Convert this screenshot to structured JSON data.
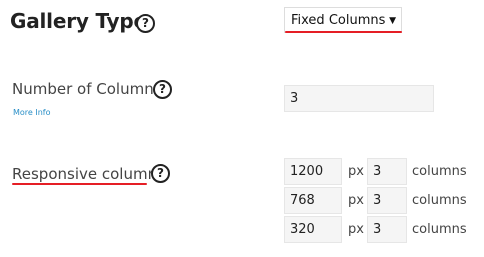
{
  "gallery_type": {
    "title": "Gallery Type",
    "help_glyph": "?",
    "select": {
      "selected": "Fixed Columns",
      "caret": "▼"
    }
  },
  "number_of_columns": {
    "label": "Number of Columns",
    "help_glyph": "?",
    "more_info": "More Info",
    "value": "3"
  },
  "responsive_columns": {
    "label": "Responsive columns",
    "help_glyph": "?",
    "unit_label": "px",
    "suffix_label": "columns",
    "rows": [
      {
        "width": "1200",
        "columns": "3"
      },
      {
        "width": "768",
        "columns": "3"
      },
      {
        "width": "320",
        "columns": "3"
      }
    ]
  },
  "colors": {
    "highlight_underline": "#e51e25",
    "link": "#2a8fc7",
    "input_background": "#f5f5f5"
  },
  "icons": [
    "question-circle-icon",
    "dropdown-caret-icon"
  ]
}
